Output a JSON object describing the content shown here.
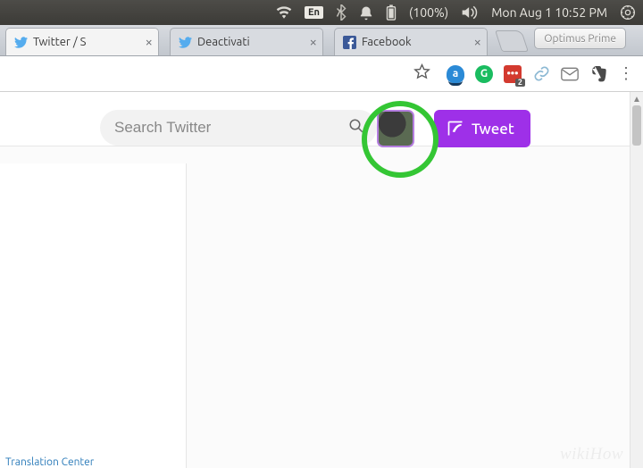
{
  "menubar": {
    "language": "En",
    "battery": "(100%)",
    "datetime": "Mon Aug  1 10:52 PM"
  },
  "browser": {
    "tabs": [
      {
        "title": "Twitter / S",
        "favicon": "twitter",
        "active": true
      },
      {
        "title": "Deactivati",
        "favicon": "twitter",
        "active": false
      },
      {
        "title": "Facebook",
        "favicon": "facebook",
        "active": false
      }
    ],
    "window_label": "Optimus Prime",
    "extensions": {
      "amazon": "a",
      "grammarly": "G",
      "lastpass": "•••",
      "lastpass_badge": "2"
    }
  },
  "page": {
    "search_placeholder": "Search Twitter",
    "tweet_label": "Tweet",
    "footer_link": "Translation Center"
  },
  "watermark": "wikiHow"
}
